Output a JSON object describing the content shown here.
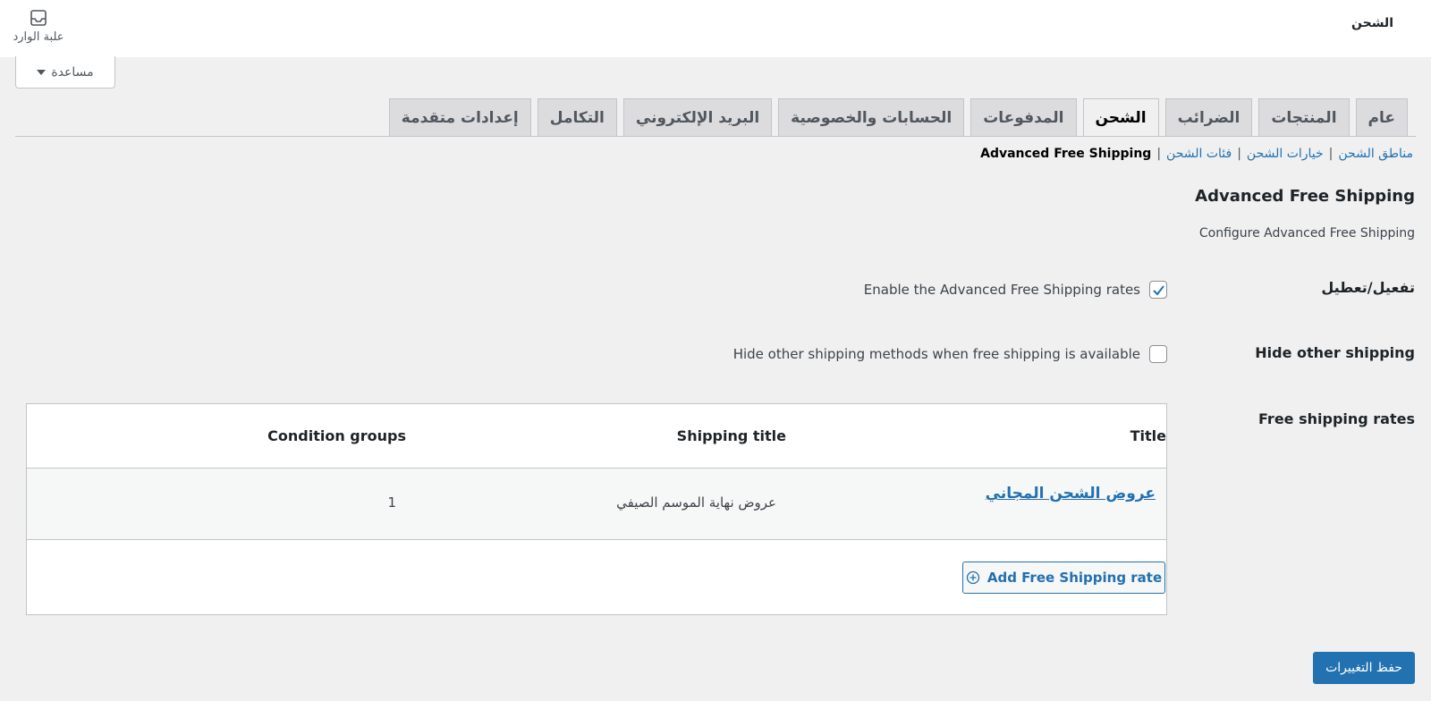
{
  "header": {
    "page_title": "الشحن",
    "inbox_label": "علبة الوارد",
    "help_label": "مساعدة"
  },
  "tabs": [
    {
      "label": "عام",
      "active": false
    },
    {
      "label": "المنتجات",
      "active": false
    },
    {
      "label": "الضرائب",
      "active": false
    },
    {
      "label": "الشحن",
      "active": true
    },
    {
      "label": "المدفوعات",
      "active": false
    },
    {
      "label": "الحسابات والخصوصية",
      "active": false
    },
    {
      "label": "البريد الإلكتروني",
      "active": false
    },
    {
      "label": "التكامل",
      "active": false
    },
    {
      "label": "إعدادات متقدمة",
      "active": false
    }
  ],
  "subnav": {
    "zones": "مناطق الشحن",
    "options": "خيارات الشحن",
    "classes": "فئات الشحن",
    "current": "Advanced Free Shipping",
    "separator": "|"
  },
  "section": {
    "title": "Advanced Free Shipping",
    "description": "Configure Advanced Free Shipping"
  },
  "settings": {
    "enable_label": "تفعيل/تعطيل",
    "enable_text": "Enable the Advanced Free Shipping rates",
    "enable_checked": true,
    "hide_label": "Hide other shipping",
    "hide_text": "Hide other shipping methods when free shipping is available",
    "hide_checked": false,
    "rates_label": "Free shipping rates"
  },
  "rates_table": {
    "headers": {
      "title": "Title",
      "shipping_title": "Shipping title",
      "condition_groups": "Condition groups"
    },
    "rows": [
      {
        "title": "عروض الشحن المجاني",
        "shipping_title": "عروض نهاية الموسم الصيفي",
        "condition_groups": "1"
      }
    ],
    "add_button": "Add Free Shipping rate"
  },
  "footer": {
    "save_label": "حفظ التغييرات"
  },
  "colors": {
    "accent": "#2271b1",
    "background": "#f0f0f1",
    "tab_inactive": "#dcdcde"
  }
}
